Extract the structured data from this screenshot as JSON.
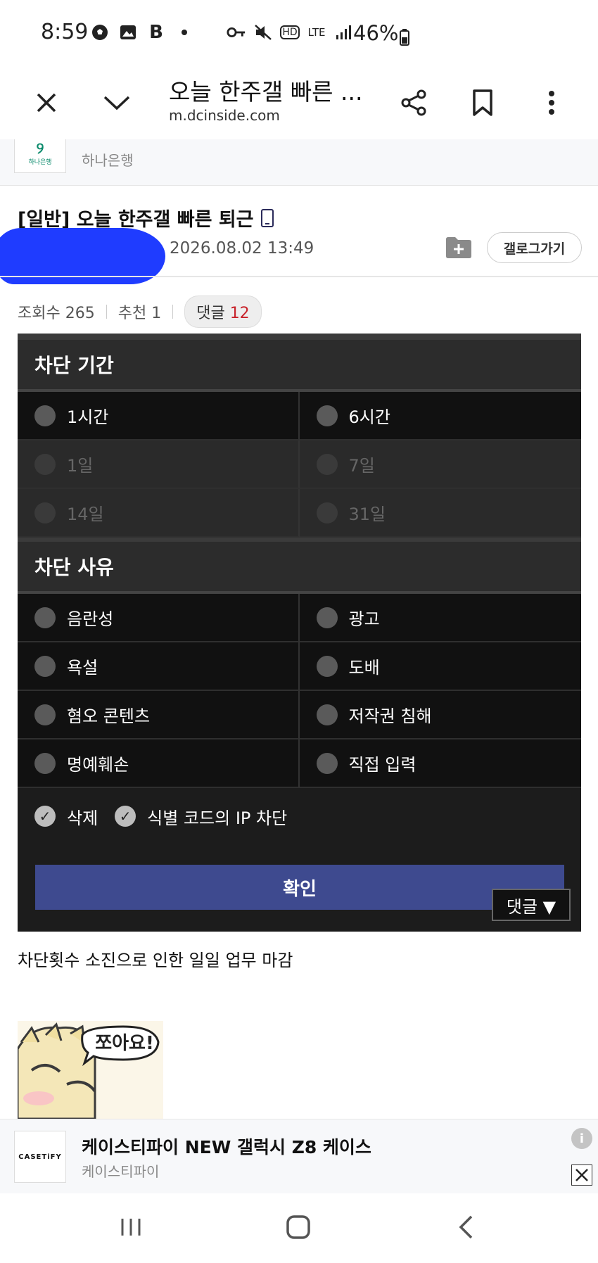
{
  "status_bar": {
    "time": "8:59",
    "left_icons": [
      "soccer-ball-icon",
      "image-icon",
      "b-icon",
      "dot-icon"
    ],
    "right_icons": [
      "key-icon",
      "mute-icon",
      "hd-icon",
      "lte-icon",
      "signal-icon"
    ],
    "battery": "46%"
  },
  "browser": {
    "title": "오늘 한주갤 빠른 ...",
    "url": "m.dcinside.com"
  },
  "top_ad": {
    "logo_text": "하나은행",
    "advertiser": "하나은행"
  },
  "post": {
    "title": "[일반] 오늘 한주갤 빠른 퇴근",
    "date": "2026.08.02 13:49",
    "gallery_button": "갤로그가기",
    "views_label": "조회수 265",
    "recommend_label": "추천 1",
    "comment_label": "댓글",
    "comment_count": "12",
    "body_text": "차단횟수 소진으로 인한 일일 업무 마감"
  },
  "block_panel": {
    "period_heading": "차단 기간",
    "periods": [
      "1시간",
      "6시간",
      "1일",
      "7일",
      "14일",
      "31일"
    ],
    "reason_heading": "차단 사유",
    "reasons": [
      "음란성",
      "광고",
      "욕설",
      "도배",
      "혐오 콘텐츠",
      "저작권 침해",
      "명예훼손",
      "직접 입력"
    ],
    "check_delete": "삭제",
    "check_ip": "식별 코드의 IP 차단",
    "confirm": "확인",
    "comment_float": "댓글 ▼"
  },
  "sticker": {
    "text": "쪼아요!"
  },
  "bottom_ad": {
    "logo_text": "CASETiFY",
    "title": "케이스티파이 NEW 갤럭시 Z8 케이스",
    "advertiser": "케이스티파이"
  }
}
